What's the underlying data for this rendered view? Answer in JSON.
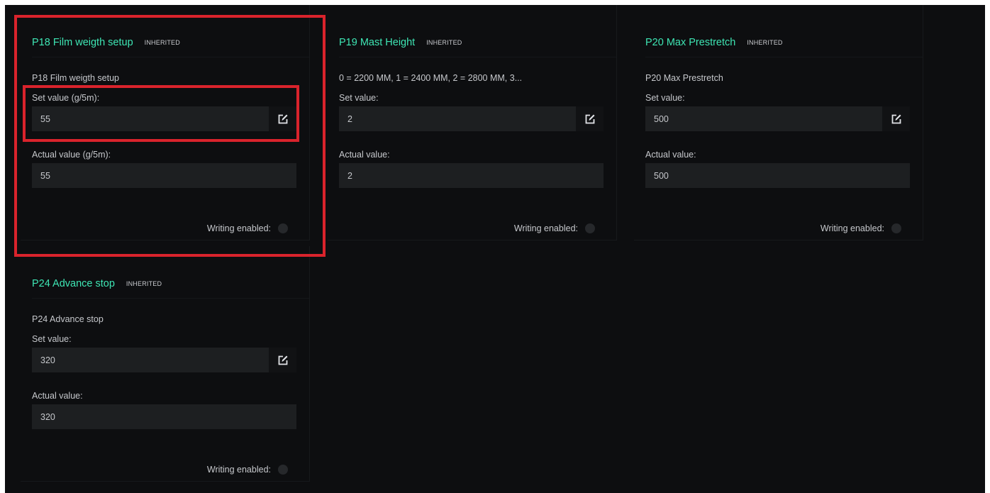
{
  "cards": [
    {
      "title": "P18 Film weigth setup",
      "badge": "INHERITED",
      "description": "P18 Film weigth setup",
      "set_label": "Set value (g/5m):",
      "set_value": "55",
      "actual_label": "Actual value (g/5m):",
      "actual_value": "55",
      "writing_label": "Writing enabled:"
    },
    {
      "title": "P19 Mast Height",
      "badge": "INHERITED",
      "description": "0 = 2200 MM, 1 = 2400 MM, 2 = 2800 MM, 3...",
      "set_label": "Set value:",
      "set_value": "2",
      "actual_label": "Actual value:",
      "actual_value": "2",
      "writing_label": "Writing enabled:"
    },
    {
      "title": "P20 Max Prestretch",
      "badge": "INHERITED",
      "description": "P20 Max Prestretch",
      "set_label": "Set value:",
      "set_value": "500",
      "actual_label": "Actual value:",
      "actual_value": "500",
      "writing_label": "Writing enabled:"
    },
    {
      "title": "P24 Advance stop",
      "badge": "INHERITED",
      "description": "P24 Advance stop",
      "set_label": "Set value:",
      "set_value": "320",
      "actual_label": "Actual value:",
      "actual_value": "320",
      "writing_label": "Writing enabled:"
    }
  ],
  "colors": {
    "background": "#0d0e10",
    "title": "#3ee6b4",
    "input": "#1d1f21",
    "highlight": "#d9232c"
  },
  "icons": {
    "edit": "edit-icon"
  }
}
